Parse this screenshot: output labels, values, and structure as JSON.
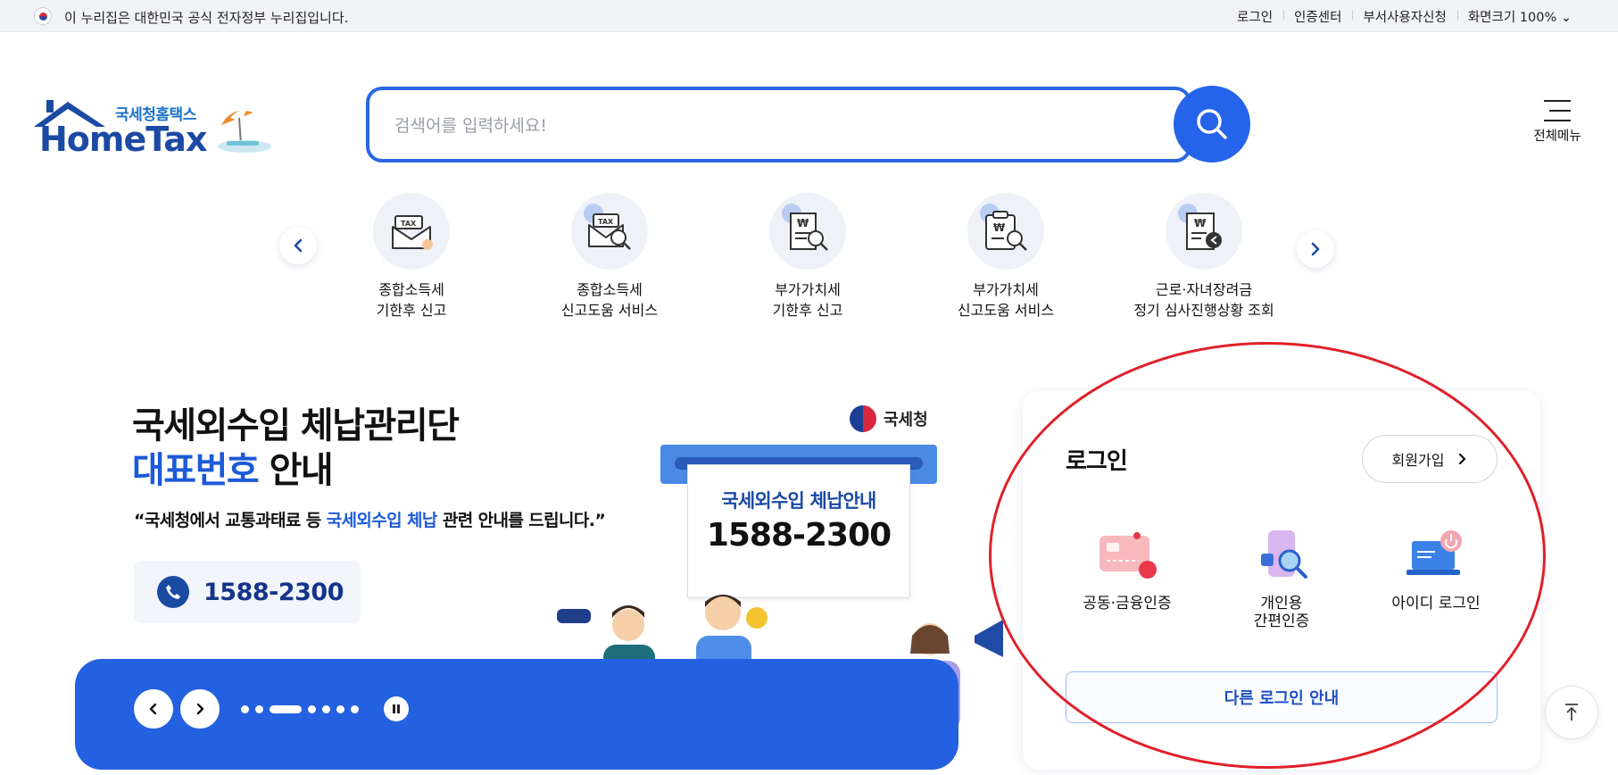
{
  "gov_bar": {
    "notice": "이 누리집은 대한민국 공식 전자정부 누리집입니다.",
    "links": [
      "로그인",
      "인증센터",
      "부서사용자신청",
      "화면크기 100% ⌄"
    ]
  },
  "logo": {
    "subtitle": "국세청홈택스",
    "name": "HomeTax"
  },
  "search": {
    "placeholder": "검색어를 입력하세요!",
    "value": ""
  },
  "menu": {
    "label": "전체메뉴"
  },
  "quick_menu": {
    "items": [
      {
        "line1": "종합소득세",
        "line2": "기한후 신고",
        "icon": "tax-envelope-icon"
      },
      {
        "line1": "종합소득세",
        "line2": "신고도움 서비스",
        "icon": "tax-search-icon"
      },
      {
        "line1": "부가가치세",
        "line2": "기한후 신고",
        "icon": "won-receipt-icon"
      },
      {
        "line1": "부가가치세",
        "line2": "신고도움 서비스",
        "icon": "won-clipboard-search-icon"
      },
      {
        "line1": "근로·자녀장려금",
        "line2": "정기 심사진행상황 조회",
        "icon": "won-receipt-back-icon"
      }
    ]
  },
  "banner": {
    "title_line1": "국세외수입 체납관리단",
    "title_line2_highlight": "대표번호",
    "title_line2_rest": " 안내",
    "desc_pre": "“국세청에서 교통과태료 등 ",
    "desc_highlight": "국세외수입 체납",
    "desc_post": " 관련 안내를 드립니다.”",
    "phone": "1588-2300",
    "agency": "국세청",
    "ticket_title": "국세외수입 체납안내",
    "ticket_number": "1588-2300",
    "slide_count": 7,
    "active_slide": 3
  },
  "login": {
    "title": "로그인",
    "join_label": "회원가입",
    "options": [
      {
        "label1": "공동·금융인증",
        "label2": "",
        "icon": "certificate-card-icon"
      },
      {
        "label1": "개인용",
        "label2": "간편인증",
        "icon": "simple-auth-icon"
      },
      {
        "label1": "아이디 로그인",
        "label2": "",
        "icon": "id-login-laptop-icon"
      }
    ],
    "other_label": "다른 로그인 안내"
  },
  "colors": {
    "brand_blue": "#2461e0",
    "navy": "#1b4aa3",
    "annotation_red": "#e0202a"
  }
}
